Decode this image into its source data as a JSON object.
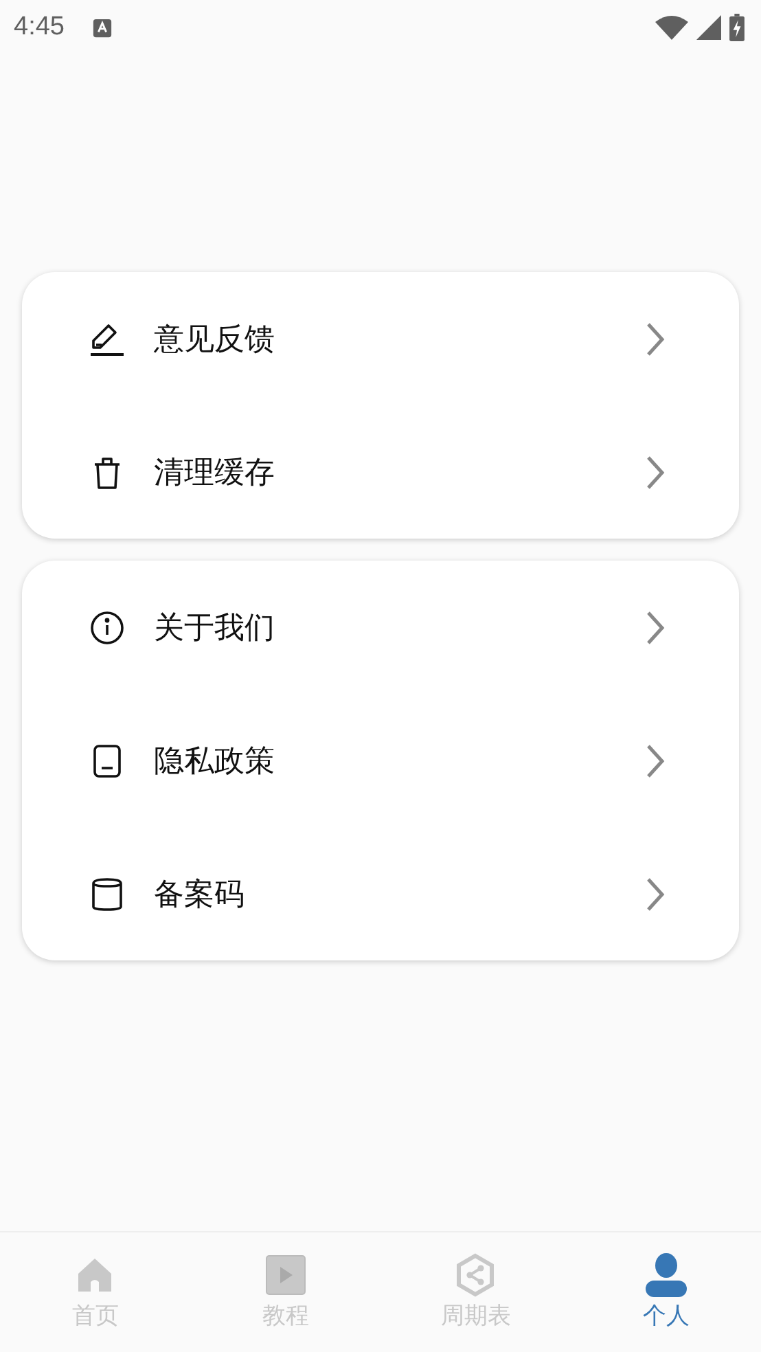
{
  "status_bar": {
    "time": "4:45"
  },
  "groups": [
    {
      "items": [
        {
          "kind": "pencil",
          "label": "意见反馈"
        },
        {
          "kind": "trash",
          "label": "清理缓存"
        }
      ]
    },
    {
      "items": [
        {
          "kind": "info",
          "label": "关于我们"
        },
        {
          "kind": "document",
          "label": "隐私政策"
        },
        {
          "kind": "cylinder",
          "label": "备案码"
        }
      ]
    }
  ],
  "tabs": [
    {
      "kind": "home",
      "label": "首页",
      "selected": false
    },
    {
      "kind": "play",
      "label": "教程",
      "selected": false
    },
    {
      "kind": "hexagon",
      "label": "周期表",
      "selected": false
    },
    {
      "kind": "person",
      "label": "个人",
      "selected": true
    }
  ]
}
